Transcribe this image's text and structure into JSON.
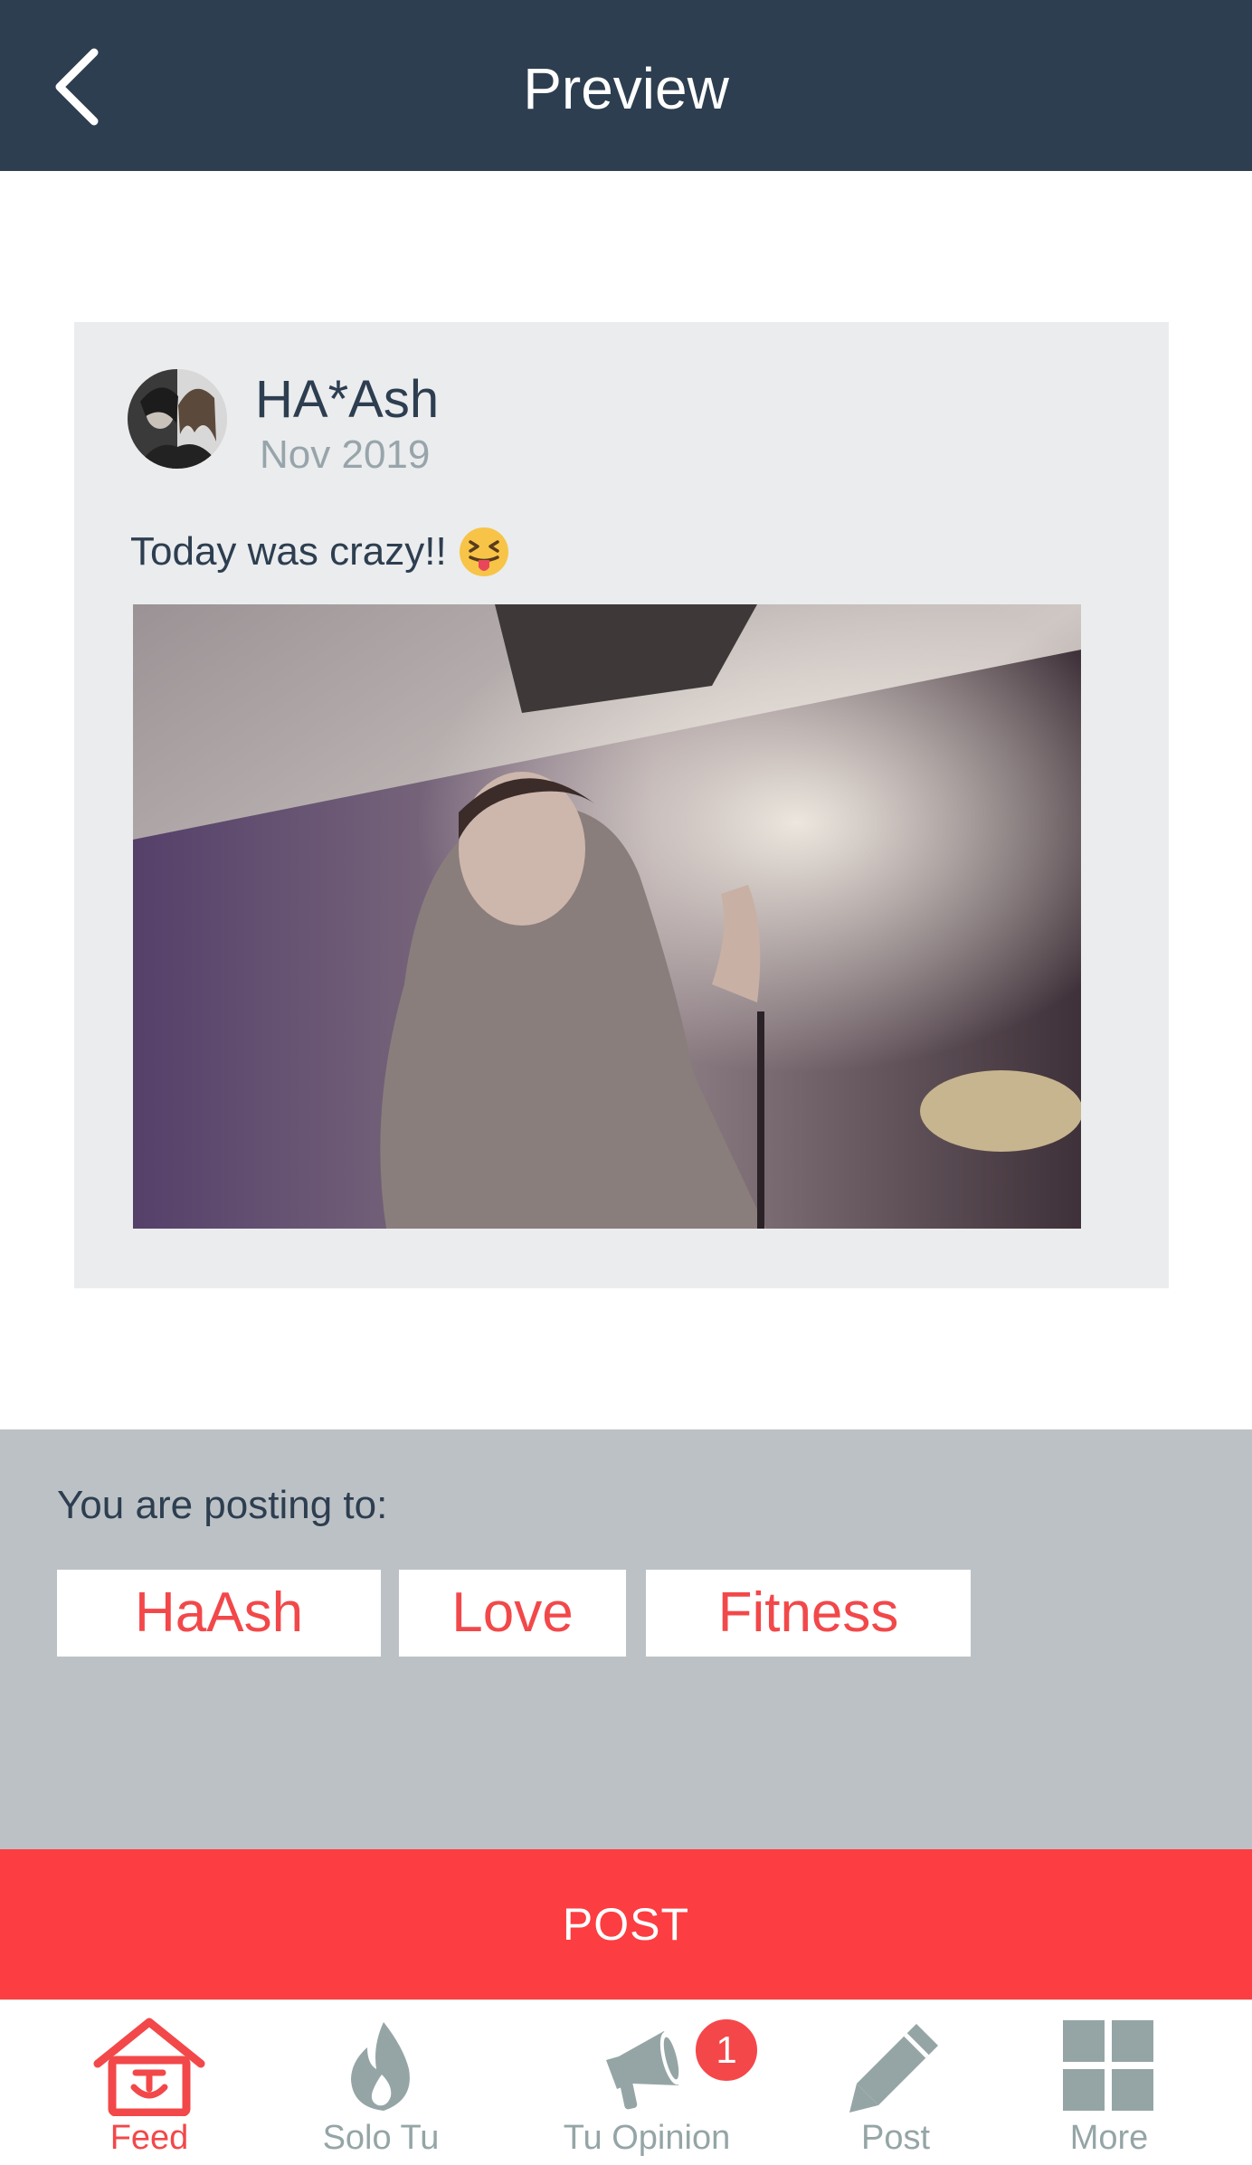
{
  "header": {
    "title": "Preview",
    "back_icon": "chevron-left-icon"
  },
  "post": {
    "author": "HA*Ash",
    "date": "Nov 2019",
    "text": "Today was crazy!!",
    "emoji": "squinting-face-with-tongue"
  },
  "posting": {
    "label": "You are posting to:",
    "channels": [
      "HaAsh",
      "Love",
      "Fitness"
    ]
  },
  "post_button": {
    "label": "POST"
  },
  "tabs": [
    {
      "label": "Feed",
      "icon": "home-icon",
      "active": true
    },
    {
      "label": "Solo Tu",
      "icon": "flame-icon",
      "active": false
    },
    {
      "label": "Tu Opinion",
      "icon": "megaphone-icon",
      "active": false,
      "badge": "1"
    },
    {
      "label": "Post",
      "icon": "pencil-icon",
      "active": false
    },
    {
      "label": "More",
      "icon": "grid-icon",
      "active": false
    }
  ],
  "colors": {
    "header_bg": "#2d3e50",
    "accent": "#fc3d42",
    "chip_text": "#f2484a",
    "posting_bg": "#bcc1c5",
    "card_bg": "#ebecee",
    "tab_inactive": "#95a5a6"
  }
}
